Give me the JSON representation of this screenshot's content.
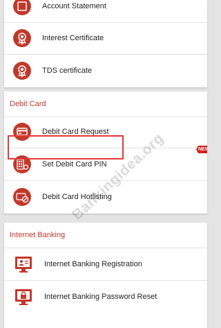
{
  "accounts_section": {
    "items": [
      {
        "label": "Account Statement",
        "icon": "statement-icon"
      },
      {
        "label": "Interest Certificate",
        "icon": "certificate-icon"
      },
      {
        "label": "TDS certificate",
        "icon": "certificate-icon"
      }
    ]
  },
  "debit_card_section": {
    "header": "Debit Card",
    "items": [
      {
        "label": "Debit Card Request",
        "icon": "card-icon"
      },
      {
        "label": "Set Debit Card PIN",
        "icon": "keypad-icon",
        "badge": "NEW"
      },
      {
        "label": "Debit Card Hotlisting",
        "icon": "block-card-icon"
      }
    ]
  },
  "internet_banking_section": {
    "header": "Internet Banking",
    "items": [
      {
        "label": "Internet Banking Registration",
        "icon": "monitor-user-icon"
      },
      {
        "label": "Internet Banking Password Reset",
        "icon": "monitor-lock-icon"
      }
    ]
  },
  "watermark": "Bankingidea.org",
  "colors": {
    "accent": "#c0392b",
    "highlight": "#e23838",
    "background": "#e4e4e4"
  }
}
